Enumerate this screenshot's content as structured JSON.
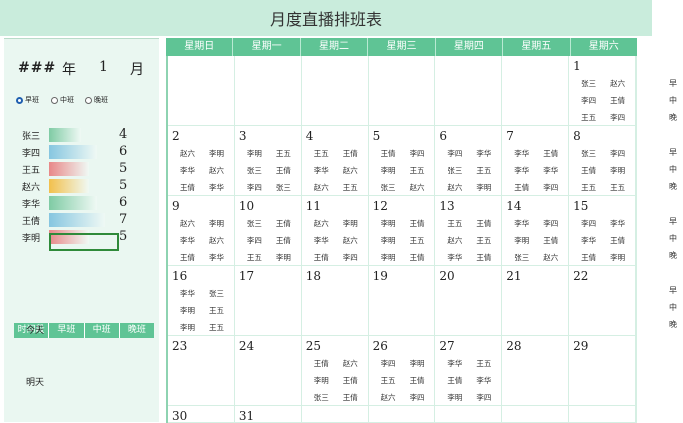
{
  "title": "月度直播排班表",
  "header": {
    "year_value": "###",
    "year_label": "年",
    "month_value": "1",
    "month_label": "月"
  },
  "shifts": [
    {
      "label": "早班",
      "selected": true
    },
    {
      "label": "中班",
      "selected": false
    },
    {
      "label": "晚班",
      "selected": false
    }
  ],
  "employees": [
    {
      "name": "张三",
      "count": "4",
      "fill": 0.5,
      "color": "#7fcba4"
    },
    {
      "name": "李四",
      "count": "6",
      "fill": 0.75,
      "color": "#86c6e0"
    },
    {
      "name": "王五",
      "count": "5",
      "fill": 0.62,
      "color": "#e88888"
    },
    {
      "name": "赵六",
      "count": "5",
      "fill": 0.62,
      "color": "#f2c04c"
    },
    {
      "name": "李华",
      "count": "6",
      "fill": 0.75,
      "color": "#7fcba4"
    },
    {
      "name": "王倩",
      "count": "7",
      "fill": 0.87,
      "color": "#86c6e0"
    },
    {
      "name": "李明",
      "count": "5",
      "fill": 0.62,
      "color": "#e88888"
    }
  ],
  "time_table": {
    "headers": [
      "时间段",
      "早班",
      "中班",
      "晚班"
    ],
    "rows": [
      "今天",
      "明天"
    ]
  },
  "weekdays": [
    "星期日",
    "星期一",
    "星期二",
    "星期三",
    "星期四",
    "星期五",
    "星期六"
  ],
  "side_labels": [
    "早",
    "中",
    "晚"
  ],
  "calendar": [
    [
      {
        "day": "",
        "names": []
      },
      {
        "day": "",
        "names": []
      },
      {
        "day": "",
        "names": []
      },
      {
        "day": "",
        "names": []
      },
      {
        "day": "",
        "names": []
      },
      {
        "day": "",
        "names": []
      },
      {
        "day": "1",
        "names": [
          "张三",
          "赵六",
          "李四",
          "王倩",
          "王五",
          "李四"
        ]
      }
    ],
    [
      {
        "day": "2",
        "names": [
          "赵六",
          "李明",
          "李华",
          "赵六",
          "王倩",
          "李华"
        ]
      },
      {
        "day": "3",
        "names": [
          "李明",
          "王五",
          "张三",
          "王倩",
          "李四",
          "张三"
        ]
      },
      {
        "day": "4",
        "names": [
          "王五",
          "王倩",
          "李华",
          "赵六",
          "赵六",
          "王五"
        ]
      },
      {
        "day": "5",
        "names": [
          "王倩",
          "李四",
          "李明",
          "王五",
          "张三",
          "赵六"
        ]
      },
      {
        "day": "6",
        "names": [
          "李四",
          "李华",
          "张三",
          "王五",
          "赵六",
          "李明"
        ]
      },
      {
        "day": "7",
        "names": [
          "李华",
          "王倩",
          "李华",
          "李华",
          "王倩",
          "李四"
        ]
      },
      {
        "day": "8",
        "names": [
          "张三",
          "李四",
          "王倩",
          "李明",
          "王五",
          "王五"
        ]
      }
    ],
    [
      {
        "day": "9",
        "names": [
          "赵六",
          "李明",
          "李华",
          "赵六",
          "王倩",
          "李华"
        ]
      },
      {
        "day": "10",
        "names": [
          "张三",
          "王倩",
          "李四",
          "王倩",
          "王五",
          "李明"
        ]
      },
      {
        "day": "11",
        "names": [
          "赵六",
          "李明",
          "李华",
          "赵六",
          "王倩",
          "李四"
        ]
      },
      {
        "day": "12",
        "names": [
          "李明",
          "王倩",
          "李明",
          "王五",
          "李明",
          "王倩"
        ]
      },
      {
        "day": "13",
        "names": [
          "王五",
          "王倩",
          "赵六",
          "王五",
          "李华",
          "王倩"
        ]
      },
      {
        "day": "14",
        "names": [
          "李华",
          "李四",
          "李明",
          "王倩",
          "张三",
          "赵六"
        ]
      },
      {
        "day": "15",
        "names": [
          "李四",
          "李华",
          "李华",
          "王倩",
          "王倩",
          "李明"
        ]
      }
    ],
    [
      {
        "day": "16",
        "names": [
          "李华",
          "张三",
          "李明",
          "王五",
          "李明",
          "王五"
        ]
      },
      {
        "day": "17",
        "names": []
      },
      {
        "day": "18",
        "names": []
      },
      {
        "day": "19",
        "names": []
      },
      {
        "day": "20",
        "names": []
      },
      {
        "day": "21",
        "names": []
      },
      {
        "day": "22",
        "names": []
      }
    ],
    [
      {
        "day": "23",
        "names": []
      },
      {
        "day": "24",
        "names": []
      },
      {
        "day": "25",
        "names": [
          "王倩",
          "赵六",
          "李明",
          "王倩",
          "张三",
          "王倩"
        ]
      },
      {
        "day": "26",
        "names": [
          "李四",
          "李明",
          "王五",
          "王倩",
          "赵六",
          "李四"
        ]
      },
      {
        "day": "27",
        "names": [
          "李华",
          "王五",
          "王倩",
          "李华",
          "李明",
          "李四"
        ]
      },
      {
        "day": "28",
        "names": []
      },
      {
        "day": "29",
        "names": []
      }
    ],
    [
      {
        "day": "30",
        "names": []
      },
      {
        "day": "31",
        "names": []
      },
      {
        "day": "",
        "names": []
      },
      {
        "day": "",
        "names": []
      },
      {
        "day": "",
        "names": []
      },
      {
        "day": "",
        "names": []
      },
      {
        "day": "",
        "names": []
      }
    ]
  ]
}
